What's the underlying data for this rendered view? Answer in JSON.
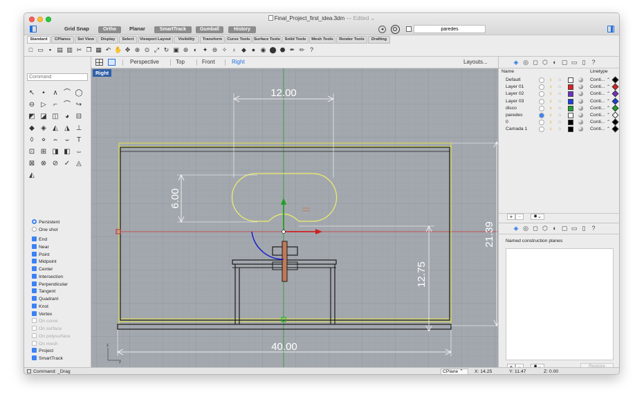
{
  "window": {
    "title": "Final_Project_first_idea.3dm",
    "edited": "— Edited ⌄"
  },
  "toolbar": {
    "grid_snap": "Grid Snap",
    "ortho": "Ortho",
    "planar": "Planar",
    "smarttrack": "SmartTrack",
    "gumball": "Gumball",
    "history": "History",
    "layer_field": "paredes"
  },
  "tabs": [
    "Standard",
    "CPlanes",
    "Set View",
    "Display",
    "Select",
    "Viewport Layout",
    "Visibility",
    "Transform",
    "Curve Tools",
    "Surface Tools",
    "Solid Tools",
    "Mesh Tools",
    "Render Tools",
    "Drafting"
  ],
  "command": {
    "placeholder": "Command",
    "status": "Command: _Drag"
  },
  "viewport_tabs": {
    "perspective": "Perspective",
    "top": "Top",
    "front": "Front",
    "right": "Right",
    "layouts": "Layouts..."
  },
  "viewport": {
    "label": "Right",
    "dimensions": {
      "top_width": "12.00",
      "ellipse_height": "6.00",
      "table_height": "12.75",
      "total_height": "21.39",
      "total_width": "40.00"
    },
    "axis": {
      "z": "z",
      "y": "y"
    }
  },
  "osnap": {
    "persistent": "Persistent",
    "one_shot": "One shot",
    "items": [
      {
        "label": "End",
        "on": true
      },
      {
        "label": "Near",
        "on": true
      },
      {
        "label": "Point",
        "on": true
      },
      {
        "label": "Midpoint",
        "on": true
      },
      {
        "label": "Center",
        "on": true
      },
      {
        "label": "Intersection",
        "on": true
      },
      {
        "label": "Perpendicular",
        "on": true
      },
      {
        "label": "Tangent",
        "on": true
      },
      {
        "label": "Quadrant",
        "on": true
      },
      {
        "label": "Knot",
        "on": true
      },
      {
        "label": "Vertex",
        "on": true
      },
      {
        "label": "On curve",
        "on": false
      },
      {
        "label": "On surface",
        "on": false
      },
      {
        "label": "On polysurface",
        "on": false
      },
      {
        "label": "On mesh",
        "on": false
      },
      {
        "label": "Project",
        "on": true
      },
      {
        "label": "SmartTrack",
        "on": true
      }
    ]
  },
  "layers": {
    "col_name": "Name",
    "col_linetype": "Linetype",
    "rows": [
      {
        "name": "Default",
        "color": "#ffffff",
        "linetype": "Conti...",
        "current": false,
        "swatch2": "#000000"
      },
      {
        "name": "Layer 01",
        "color": "#e02020",
        "linetype": "Conti...",
        "current": false,
        "swatch2": "#e02020"
      },
      {
        "name": "Layer 02",
        "color": "#7030c8",
        "linetype": "Conti...",
        "current": false,
        "swatch2": "#7030c8"
      },
      {
        "name": "Layer 03",
        "color": "#1840e0",
        "linetype": "Conti...",
        "current": false,
        "swatch2": "#1840e0"
      },
      {
        "name": "disco",
        "color": "#20a030",
        "linetype": "Conti...",
        "current": false,
        "swatch2": "#20a030"
      },
      {
        "name": "paredes",
        "color": "#ffffff",
        "linetype": "Conti...",
        "current": true,
        "swatch2": "#ffffff"
      },
      {
        "name": "0",
        "color": "#000000",
        "linetype": "Conti...",
        "current": false,
        "swatch2": "#000000"
      },
      {
        "name": "Camada 1",
        "color": "#000000",
        "linetype": "Conti...",
        "current": false,
        "swatch2": "#000000"
      }
    ]
  },
  "cplanes": {
    "title": "Named construction planes",
    "restore": "Restore"
  },
  "status": {
    "cplane": "CPlane",
    "x": "X: 14.25",
    "y": "Y: 11.47",
    "z": "Z: 0.00"
  }
}
